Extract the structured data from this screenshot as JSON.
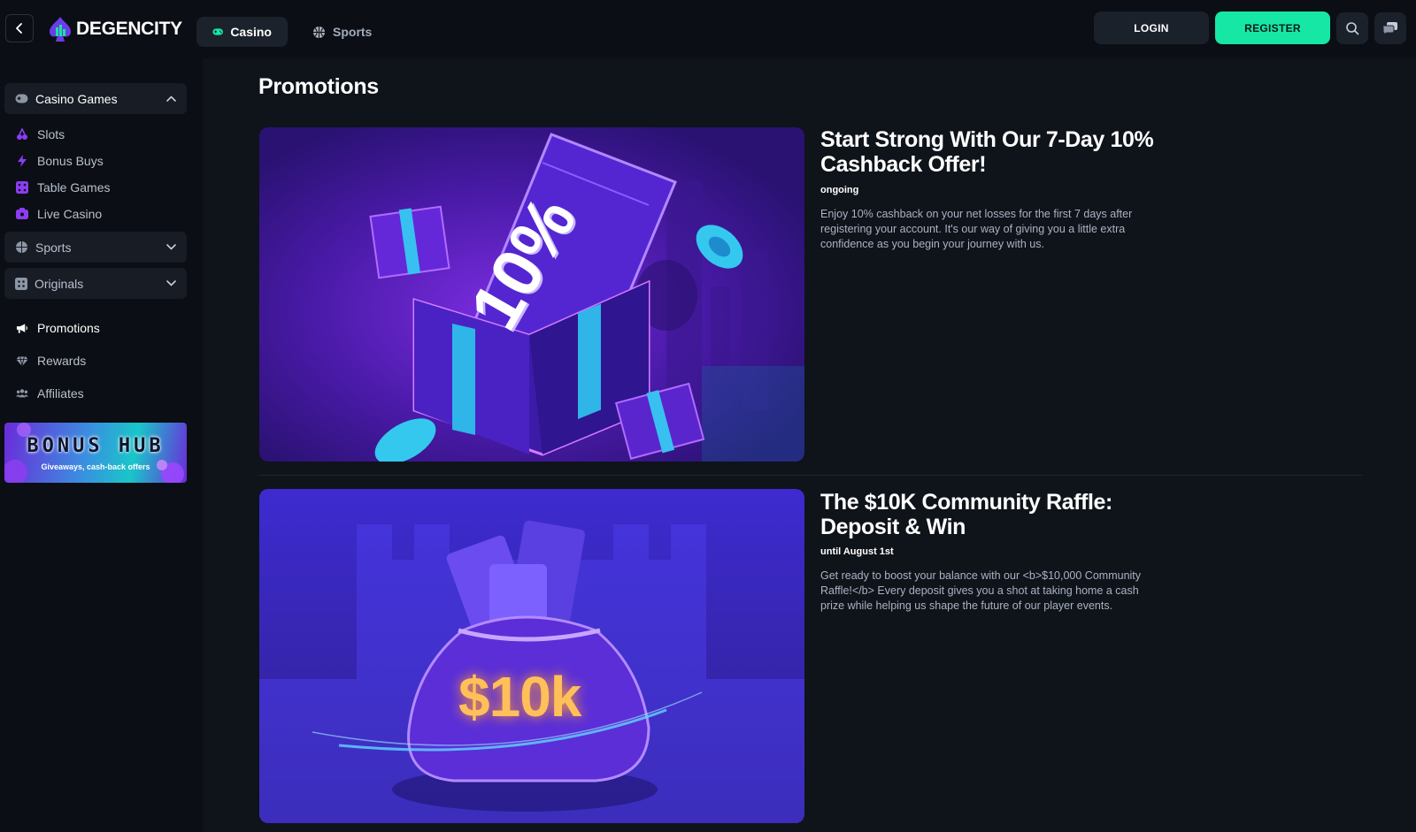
{
  "header": {
    "logo_text": "DEGENCITY",
    "tabs": [
      {
        "label": "Casino",
        "active": true
      },
      {
        "label": "Sports",
        "active": false
      }
    ],
    "login_label": "LOGIN",
    "register_label": "REGISTER"
  },
  "colors": {
    "accent": "#17e7a5",
    "sidebar_icon": "#8b3df2",
    "background": "#0f131a"
  },
  "sidebar": {
    "casino_section": "Casino Games",
    "casino_items": [
      {
        "label": "Slots",
        "icon": "slots-icon"
      },
      {
        "label": "Bonus Buys",
        "icon": "lightning-icon"
      },
      {
        "label": "Table Games",
        "icon": "dice-icon"
      },
      {
        "label": "Live Casino",
        "icon": "live-camera-icon"
      }
    ],
    "sports_section": "Sports",
    "originals_section": "Originals",
    "links": [
      {
        "label": "Promotions",
        "icon": "megaphone-icon",
        "active": true
      },
      {
        "label": "Rewards",
        "icon": "diamond-icon",
        "active": false
      },
      {
        "label": "Affiliates",
        "icon": "users-icon",
        "active": false
      }
    ],
    "banner": {
      "title": "BONUS HUB",
      "subtitle": "Giveaways, cash-back offers"
    }
  },
  "main": {
    "title": "Promotions",
    "promos": [
      {
        "title": "Start Strong With Our 7-Day 10% Cashback Offer!",
        "status": "ongoing",
        "description": "Enjoy 10% cashback on your net losses for the first 7 days after registering your account. It's our way of giving you a little extra confidence as you begin your journey with us.",
        "image_text": "10%"
      },
      {
        "title": "The $10K Community Raffle: Deposit & Win",
        "status": "until August 1st",
        "description": "Get ready to boost your balance with our <b>$10,000 Community Raffle!</b> Every deposit gives you a shot at taking home a cash prize while helping us shape the future of our player events.",
        "image_text": "$10k"
      }
    ]
  }
}
